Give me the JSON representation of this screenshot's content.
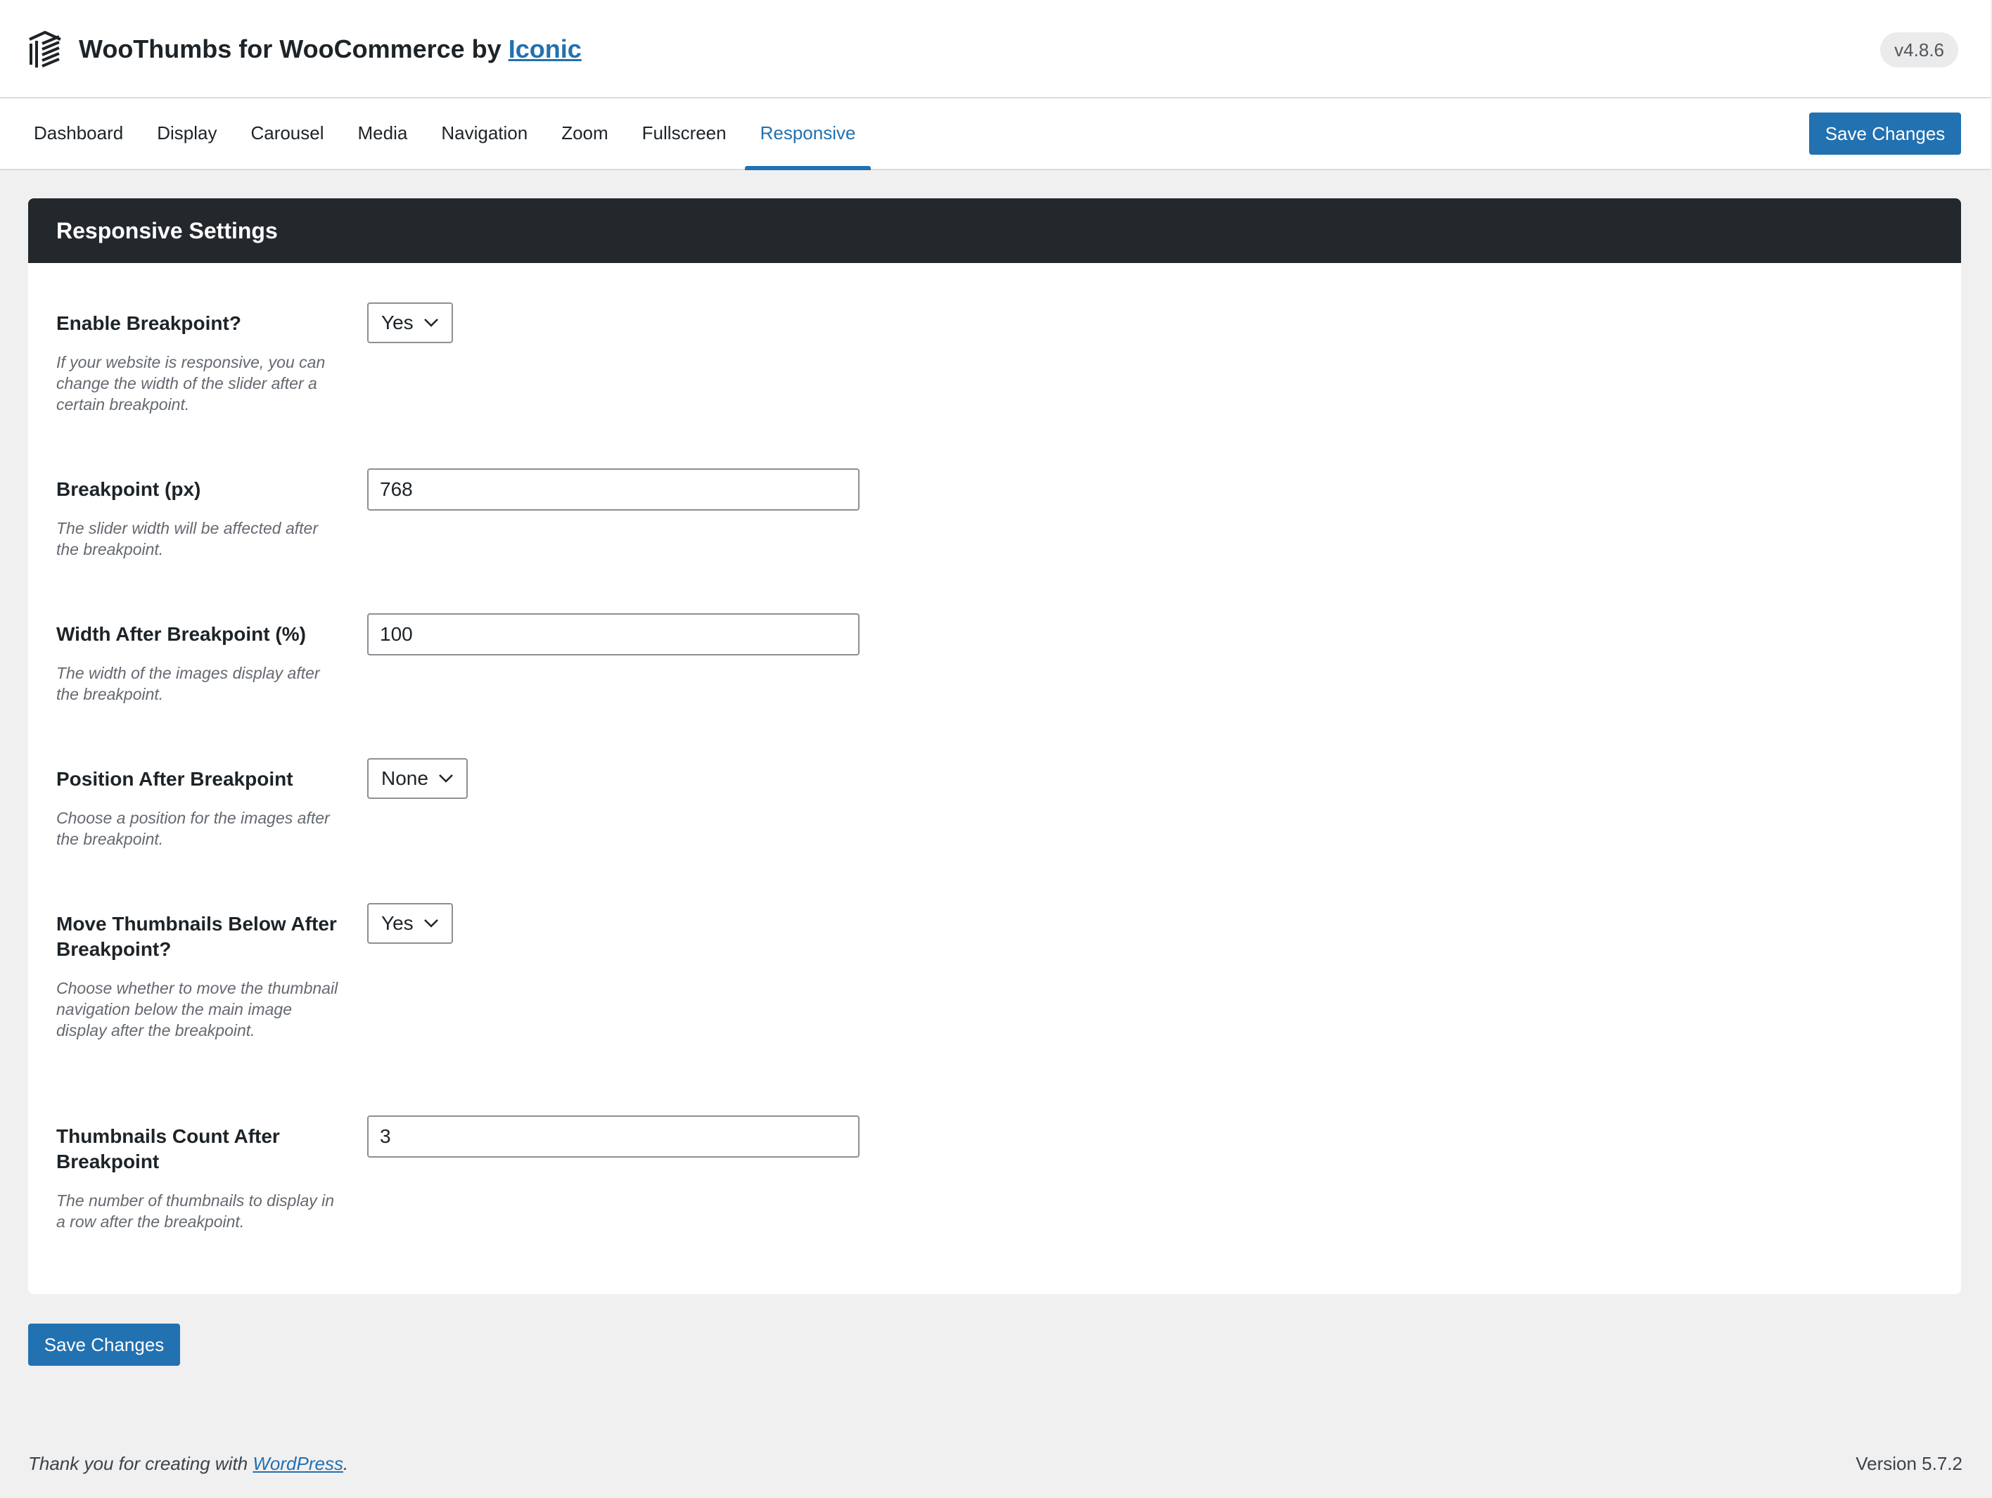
{
  "header": {
    "title_prefix": "WooThumbs for WooCommerce by ",
    "title_link": "Iconic",
    "version": "v4.8.6",
    "logo_icon": "iconic-logo-icon"
  },
  "tabs": [
    {
      "label": "Dashboard",
      "active": false
    },
    {
      "label": "Display",
      "active": false
    },
    {
      "label": "Carousel",
      "active": false
    },
    {
      "label": "Media",
      "active": false
    },
    {
      "label": "Navigation",
      "active": false
    },
    {
      "label": "Zoom",
      "active": false
    },
    {
      "label": "Fullscreen",
      "active": false
    },
    {
      "label": "Responsive",
      "active": true
    }
  ],
  "save_label": "Save Changes",
  "card": {
    "title": "Responsive Settings"
  },
  "fields": [
    {
      "label": "Enable Breakpoint?",
      "type": "select",
      "value": "Yes",
      "description": "If your website is responsive, you can change the width of the slider after a certain breakpoint."
    },
    {
      "label": "Breakpoint (px)",
      "type": "text",
      "value": "768",
      "description": "The slider width will be affected after the breakpoint."
    },
    {
      "label": "Width After Breakpoint (%)",
      "type": "text",
      "value": "100",
      "description": "The width of the images display after the breakpoint."
    },
    {
      "label": "Position After Breakpoint",
      "type": "select",
      "value": "None",
      "description": "Choose a position for the images after the breakpoint."
    },
    {
      "label": "Move Thumbnails Below After Breakpoint?",
      "type": "select",
      "value": "Yes",
      "description": "Choose whether to move the thumbnail navigation below the main image display after the breakpoint."
    },
    {
      "label": "Thumbnails Count After Breakpoint",
      "type": "text",
      "value": "3",
      "description": "The number of thumbnails to display in a row after the breakpoint."
    }
  ],
  "footer": {
    "thanks_prefix": "Thank you for creating with ",
    "thanks_link": "WordPress",
    "thanks_suffix": ".",
    "version": "Version 5.7.2"
  },
  "colors": {
    "accent": "#2271b1",
    "card_header_bg": "#23282d",
    "page_bg": "#f0f0f1"
  }
}
